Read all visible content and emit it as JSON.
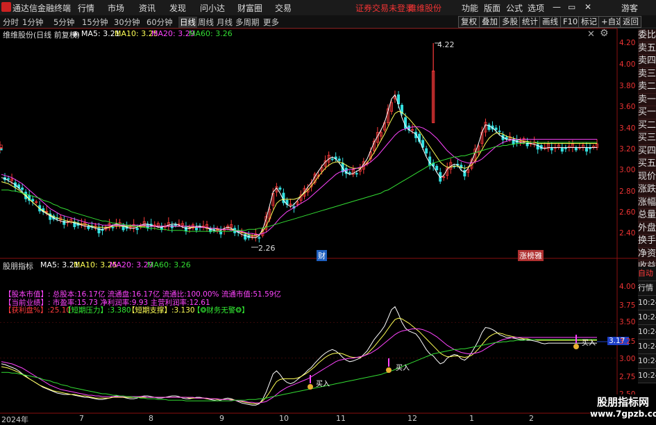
{
  "menu": {
    "app_title": "通达信金融终端",
    "items": [
      "行情",
      "市场",
      "资讯",
      "发现",
      "问小达",
      "财富圈",
      "交易"
    ],
    "notice_login": "证券交易未登录",
    "notice_stock": "维维股份",
    "right_items": [
      "功能",
      "版面",
      "公式",
      "选项"
    ],
    "guest": "游客"
  },
  "toolbar": {
    "timeframes": [
      "分时",
      "1分钟",
      "5分钟",
      "15分钟",
      "30分钟",
      "60分钟",
      "日线",
      "周线",
      "月线",
      "多周期",
      "更多"
    ],
    "active": "日线",
    "buttons": [
      "复权",
      "叠加",
      "多股",
      "统计",
      "画线",
      "F10",
      "标记",
      "+自选",
      "返回"
    ]
  },
  "main_chart": {
    "title": "维维股份(日线 前复权)",
    "ma5": "MA5: 3.21",
    "ma10": "MA10: 3.25",
    "ma20": "MA20: 3.29",
    "ma60": "MA60: 3.26",
    "high_label": "4.22",
    "low_label": "2.26",
    "marker_cai": "财",
    "marker_zhangting": "涨榜雅",
    "yticks": [
      "4.20",
      "4.00",
      "3.80",
      "3.60",
      "3.40",
      "3.20",
      "3.00",
      "2.80",
      "2.60",
      "2.40"
    ]
  },
  "indicator": {
    "title": "股朋指标",
    "ma5": "MA5: 3.21",
    "ma10": "MA10: 3.25",
    "ma20": "MA20: 3.29",
    "ma60": "MA60: 3.26",
    "line1": "【股本市值】: 总股本:16.17亿 流通盘:16.17亿 流通比:100.00% 流通市值:51.59亿",
    "line2": "【当前业绩】: 市盈率:15.73 净利润率:9.93 主营利润率:12.61",
    "line3_a": "【获利盘%】:25.10",
    "line3_b": "【短期压力】:3.380",
    "line3_c": "【短期支撑】:3.130",
    "line3_d": "【❂财务无警❂】",
    "buy_label": "买入",
    "price_tag": "3.17",
    "yticks": [
      "4.00",
      "3.75",
      "3.50",
      "3.25",
      "3.00",
      "2.75",
      "2.50"
    ]
  },
  "xaxis": {
    "labels": [
      "2024年",
      "7",
      "8",
      "9",
      "10",
      "11",
      "12",
      "1",
      "2"
    ]
  },
  "right_panel": {
    "order_book": [
      "委比",
      "卖五",
      "卖四",
      "卖三",
      "卖二",
      "卖一",
      "买一",
      "买二",
      "买三",
      "买四",
      "买五",
      "现价",
      "涨跌",
      "涨幅",
      "总量",
      "外盘",
      "换手",
      "净资",
      "收益"
    ],
    "bottom": [
      "自动",
      "行情"
    ],
    "times": [
      "10:24",
      "10:24",
      "10:24",
      "10:24",
      "10:24",
      "10:24",
      "10:24",
      "10:24"
    ]
  },
  "watermark": {
    "line1": "股朋指标网",
    "line2": "www.7gpzb.com"
  },
  "colors": {
    "up": "#ff3b3b",
    "down": "#33e0e0",
    "ma5": "#ffffff",
    "ma10": "#ffff55",
    "ma20": "#ff44ff",
    "ma60": "#33dd33"
  },
  "chart_data": {
    "type": "line",
    "x": [
      0,
      5,
      10,
      15,
      20,
      25,
      30,
      35,
      40,
      45,
      50,
      55,
      60,
      65,
      70,
      75,
      80,
      85,
      90,
      95,
      100,
      105,
      110,
      115,
      120,
      125,
      130,
      135,
      140,
      145,
      150,
      155,
      160,
      165,
      170,
      175,
      180,
      185,
      190,
      195,
      200,
      205,
      210,
      215,
      220,
      225,
      230,
      235,
      240,
      245,
      250,
      255,
      260,
      265,
      270,
      275,
      280,
      285,
      290,
      295,
      300,
      305,
      310,
      315,
      320,
      325,
      330,
      335,
      340,
      345,
      350,
      355,
      360,
      365,
      370,
      375,
      380,
      385,
      390,
      395,
      400,
      405,
      410,
      415,
      420,
      425,
      430,
      435,
      440,
      445,
      450,
      455,
      460,
      465,
      470,
      475,
      480,
      485,
      490,
      495,
      500,
      505,
      510,
      515,
      520,
      525,
      530,
      535,
      540,
      545,
      550,
      555,
      560,
      565,
      570,
      575,
      580,
      585,
      590,
      595,
      600,
      605,
      610,
      615,
      620,
      625,
      630,
      635,
      640,
      645,
      650,
      655,
      660,
      665,
      670,
      675,
      680,
      685,
      690,
      695,
      700,
      705,
      710,
      715,
      720,
      725,
      730,
      735,
      740,
      745,
      750,
      755,
      760,
      765,
      770,
      775,
      780,
      785,
      790,
      795,
      800,
      805,
      810,
      815,
      820,
      825,
      830,
      835,
      840,
      845,
      850,
      855
    ],
    "series": [
      {
        "name": "MA5",
        "values": [
          2.92,
          2.91,
          2.89,
          2.87,
          2.85,
          2.82,
          2.78,
          2.75,
          2.71,
          2.68,
          2.65,
          2.62,
          2.59,
          2.57,
          2.55,
          2.53,
          2.51,
          2.5,
          2.49,
          2.49,
          2.49,
          2.48,
          2.47,
          2.46,
          2.45,
          2.45,
          2.44,
          2.43,
          2.42,
          2.42,
          2.43,
          2.44,
          2.46,
          2.47,
          2.46,
          2.45,
          2.44,
          2.43,
          2.43,
          2.44,
          2.46,
          2.47,
          2.47,
          2.46,
          2.45,
          2.44,
          2.44,
          2.45,
          2.46,
          2.47,
          2.47,
          2.46,
          2.44,
          2.43,
          2.43,
          2.44,
          2.45,
          2.45,
          2.44,
          2.43,
          2.42,
          2.41,
          2.4,
          2.41,
          2.43,
          2.44,
          2.43,
          2.41,
          2.39,
          2.37,
          2.36,
          2.35,
          2.34,
          2.34,
          2.36,
          2.42,
          2.52,
          2.65,
          2.78,
          2.82,
          2.77,
          2.7,
          2.66,
          2.64,
          2.66,
          2.7,
          2.74,
          2.78,
          2.83,
          2.87,
          2.93,
          2.98,
          3.03,
          3.07,
          3.1,
          3.12,
          3.1,
          3.06,
          3.01,
          2.97,
          2.95,
          2.96,
          2.98,
          3.0,
          3.05,
          3.1,
          3.18,
          3.26,
          3.32,
          3.38,
          3.45,
          3.56,
          3.68,
          3.72,
          3.62,
          3.5,
          3.42,
          3.38,
          3.36,
          3.34,
          3.28,
          3.2,
          3.12,
          3.06,
          3.03,
          2.97,
          2.92,
          2.94,
          3.0,
          3.03,
          3.05,
          3.04,
          2.99,
          2.97,
          3.01,
          3.08,
          3.16,
          3.25,
          3.36,
          3.43,
          3.42,
          3.4,
          3.37,
          3.33,
          3.31,
          3.29,
          3.29,
          3.28,
          3.27,
          3.26,
          3.26,
          3.25,
          3.25,
          3.24,
          3.23,
          3.21,
          3.2,
          3.21,
          3.21,
          3.21,
          3.21,
          3.21,
          3.21,
          3.21,
          3.21,
          3.21,
          3.21,
          3.21,
          3.21,
          3.21,
          3.21,
          3.21,
          3.21,
          3.21,
          3.21
        ]
      },
      {
        "name": "MA10",
        "values": [
          2.88,
          2.87,
          2.86,
          2.84,
          2.82,
          2.8,
          2.77,
          2.74,
          2.71,
          2.68,
          2.65,
          2.62,
          2.6,
          2.58,
          2.56,
          2.54,
          2.53,
          2.52,
          2.51,
          2.5,
          2.49,
          2.49,
          2.48,
          2.47,
          2.47,
          2.46,
          2.45,
          2.44,
          2.44,
          2.44,
          2.44,
          2.44,
          2.45,
          2.45,
          2.45,
          2.45,
          2.45,
          2.45,
          2.45,
          2.45,
          2.45,
          2.45,
          2.45,
          2.45,
          2.45,
          2.45,
          2.45,
          2.45,
          2.45,
          2.45,
          2.45,
          2.45,
          2.45,
          2.45,
          2.44,
          2.44,
          2.44,
          2.44,
          2.44,
          2.43,
          2.43,
          2.43,
          2.42,
          2.42,
          2.42,
          2.42,
          2.42,
          2.41,
          2.4,
          2.39,
          2.38,
          2.37,
          2.36,
          2.36,
          2.37,
          2.4,
          2.45,
          2.52,
          2.6,
          2.67,
          2.7,
          2.71,
          2.71,
          2.71,
          2.71,
          2.72,
          2.74,
          2.77,
          2.8,
          2.84,
          2.88,
          2.93,
          2.97,
          3.01,
          3.04,
          3.06,
          3.07,
          3.07,
          3.06,
          3.04,
          3.02,
          3.01,
          3.01,
          3.01,
          3.03,
          3.06,
          3.11,
          3.16,
          3.22,
          3.28,
          3.34,
          3.41,
          3.48,
          3.54,
          3.56,
          3.55,
          3.52,
          3.49,
          3.45,
          3.41,
          3.37,
          3.32,
          3.27,
          3.22,
          3.17,
          3.12,
          3.07,
          3.04,
          3.02,
          3.02,
          3.03,
          3.03,
          3.02,
          3.01,
          3.02,
          3.04,
          3.08,
          3.13,
          3.19,
          3.25,
          3.3,
          3.33,
          3.35,
          3.35,
          3.34,
          3.32,
          3.31,
          3.3,
          3.29,
          3.28,
          3.27,
          3.27,
          3.26,
          3.26,
          3.25,
          3.25,
          3.25,
          3.25,
          3.25,
          3.25,
          3.25,
          3.25,
          3.25,
          3.25,
          3.25,
          3.25,
          3.25,
          3.25,
          3.25,
          3.25,
          3.25,
          3.25,
          3.25,
          3.25,
          3.25
        ]
      },
      {
        "name": "MA20",
        "values": [
          2.95,
          2.94,
          2.93,
          2.92,
          2.9,
          2.88,
          2.86,
          2.83,
          2.8,
          2.77,
          2.74,
          2.71,
          2.68,
          2.65,
          2.62,
          2.6,
          2.58,
          2.56,
          2.55,
          2.54,
          2.53,
          2.52,
          2.51,
          2.5,
          2.49,
          2.48,
          2.48,
          2.47,
          2.47,
          2.46,
          2.46,
          2.46,
          2.46,
          2.46,
          2.46,
          2.46,
          2.46,
          2.46,
          2.46,
          2.46,
          2.46,
          2.46,
          2.45,
          2.45,
          2.45,
          2.45,
          2.45,
          2.45,
          2.45,
          2.45,
          2.45,
          2.45,
          2.45,
          2.45,
          2.45,
          2.45,
          2.44,
          2.44,
          2.44,
          2.44,
          2.43,
          2.43,
          2.43,
          2.42,
          2.42,
          2.42,
          2.41,
          2.41,
          2.4,
          2.4,
          2.39,
          2.38,
          2.38,
          2.37,
          2.37,
          2.38,
          2.39,
          2.42,
          2.45,
          2.49,
          2.53,
          2.56,
          2.59,
          2.61,
          2.63,
          2.65,
          2.67,
          2.69,
          2.71,
          2.74,
          2.77,
          2.8,
          2.83,
          2.86,
          2.89,
          2.92,
          2.95,
          2.97,
          2.98,
          2.99,
          3.0,
          3.0,
          3.01,
          3.02,
          3.03,
          3.05,
          3.07,
          3.1,
          3.13,
          3.17,
          3.21,
          3.25,
          3.29,
          3.33,
          3.36,
          3.38,
          3.39,
          3.4,
          3.41,
          3.41,
          3.41,
          3.4,
          3.38,
          3.36,
          3.33,
          3.3,
          3.26,
          3.22,
          3.18,
          3.15,
          3.12,
          3.1,
          3.08,
          3.07,
          3.06,
          3.06,
          3.07,
          3.08,
          3.1,
          3.13,
          3.16,
          3.19,
          3.22,
          3.24,
          3.26,
          3.27,
          3.28,
          3.29,
          3.29,
          3.29,
          3.29,
          3.29,
          3.29,
          3.29,
          3.29,
          3.29,
          3.29,
          3.29,
          3.29,
          3.29,
          3.29,
          3.29,
          3.29,
          3.29,
          3.29,
          3.29,
          3.29,
          3.29,
          3.29,
          3.29,
          3.29,
          3.29,
          3.29
        ]
      },
      {
        "name": "MA60",
        "values": [
          2.8,
          2.8,
          2.8,
          2.79,
          2.79,
          2.78,
          2.77,
          2.76,
          2.75,
          2.74,
          2.73,
          2.72,
          2.7,
          2.69,
          2.68,
          2.66,
          2.65,
          2.63,
          2.62,
          2.61,
          2.59,
          2.58,
          2.57,
          2.56,
          2.55,
          2.54,
          2.53,
          2.52,
          2.51,
          2.5,
          2.5,
          2.49,
          2.48,
          2.48,
          2.47,
          2.47,
          2.46,
          2.46,
          2.45,
          2.45,
          2.44,
          2.44,
          2.43,
          2.43,
          2.43,
          2.42,
          2.42,
          2.42,
          2.41,
          2.41,
          2.41,
          2.41,
          2.41,
          2.4,
          2.4,
          2.4,
          2.4,
          2.4,
          2.4,
          2.4,
          2.4,
          2.4,
          2.4,
          2.4,
          2.4,
          2.4,
          2.4,
          2.41,
          2.41,
          2.41,
          2.41,
          2.42,
          2.42,
          2.42,
          2.43,
          2.43,
          2.44,
          2.45,
          2.46,
          2.47,
          2.48,
          2.49,
          2.5,
          2.51,
          2.52,
          2.53,
          2.54,
          2.55,
          2.56,
          2.57,
          2.58,
          2.59,
          2.6,
          2.61,
          2.62,
          2.63,
          2.64,
          2.65,
          2.66,
          2.67,
          2.68,
          2.69,
          2.7,
          2.71,
          2.72,
          2.73,
          2.74,
          2.75,
          2.76,
          2.77,
          2.79,
          2.8,
          2.82,
          2.84,
          2.86,
          2.88,
          2.9,
          2.92,
          2.94,
          2.96,
          2.98,
          3.0,
          3.02,
          3.04,
          3.06,
          3.07,
          3.08,
          3.09,
          3.1,
          3.11,
          3.12,
          3.12,
          3.13,
          3.13,
          3.14,
          3.15,
          3.16,
          3.17,
          3.18,
          3.19,
          3.2,
          3.21,
          3.22,
          3.22,
          3.23,
          3.23,
          3.24,
          3.24,
          3.25,
          3.25,
          3.25,
          3.26,
          3.26,
          3.26,
          3.26,
          3.26,
          3.26,
          3.26,
          3.26,
          3.26,
          3.26,
          3.26,
          3.26,
          3.26,
          3.26,
          3.26,
          3.26,
          3.26,
          3.26,
          3.26,
          3.26,
          3.26,
          3.26
        ]
      }
    ],
    "ylim_main": [
      2.26,
      4.22
    ],
    "ylim_indicator": [
      2.5,
      4.0
    ]
  }
}
